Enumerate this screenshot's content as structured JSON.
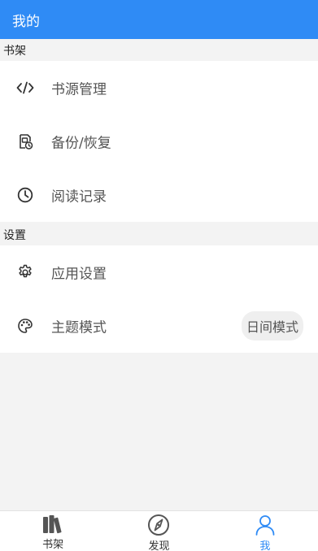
{
  "appbar": {
    "title": "我的"
  },
  "bookshelf_section": {
    "header": "书架",
    "items": [
      {
        "label": "书源管理",
        "icon": "code-icon"
      },
      {
        "label": "备份/恢复",
        "icon": "backup-icon"
      },
      {
        "label": "阅读记录",
        "icon": "clock-icon"
      }
    ]
  },
  "settings_section": {
    "header": "设置",
    "items": [
      {
        "label": "应用设置",
        "icon": "gear-icon"
      },
      {
        "label": "主题模式",
        "icon": "palette-icon",
        "value": "日间模式"
      }
    ]
  },
  "bottom_nav": {
    "items": [
      {
        "label": "书架",
        "icon": "books-icon",
        "active": false
      },
      {
        "label": "发现",
        "icon": "compass-icon",
        "active": false
      },
      {
        "label": "我",
        "icon": "person-icon",
        "active": true
      }
    ]
  },
  "colors": {
    "primary": "#2f8bf5",
    "background": "#f3f3f3"
  }
}
